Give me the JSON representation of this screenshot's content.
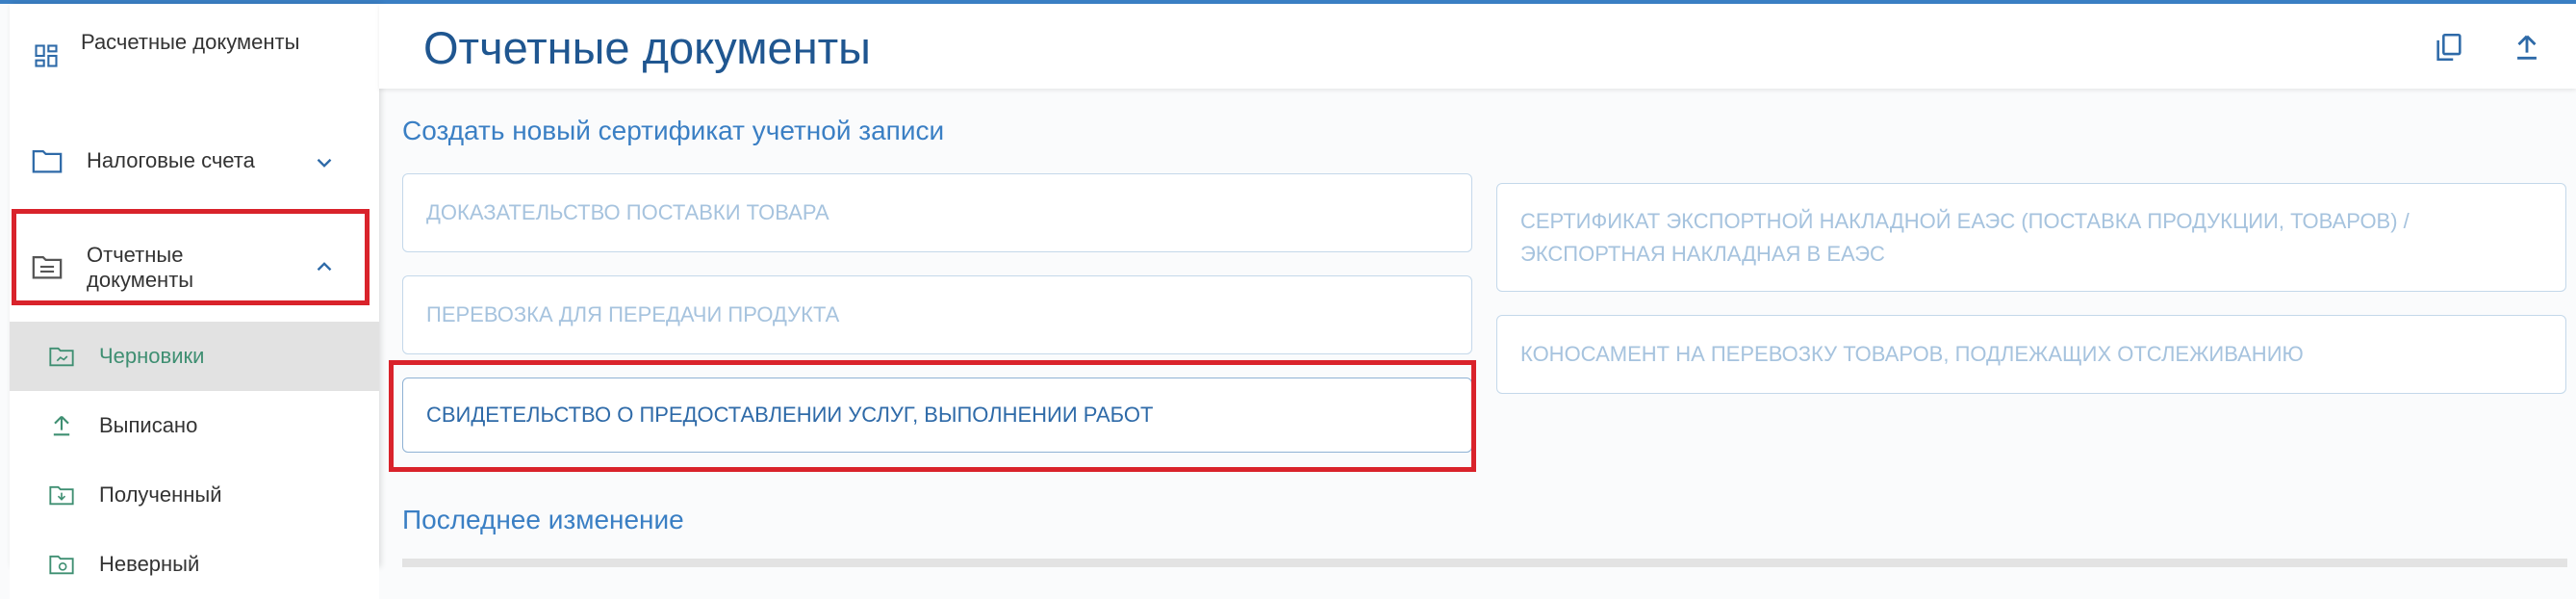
{
  "sidebar": {
    "header_label": "Расчетные документы",
    "items": [
      {
        "label": "Налоговые счета",
        "expanded": false
      },
      {
        "label": "Отчетные документы",
        "expanded": true,
        "children": [
          {
            "label": "Черновики",
            "active": true
          },
          {
            "label": "Выписано"
          },
          {
            "label": "Полученный"
          },
          {
            "label": "Неверный"
          }
        ]
      }
    ]
  },
  "header": {
    "title": "Отчетные документы",
    "icons": [
      "copy-icon",
      "upload-icon"
    ]
  },
  "create_section": {
    "title": "Создать новый сертификат учетной записи",
    "left_cards": [
      "ДОКАЗАТЕЛЬСТВО ПОСТАВКИ ТОВАРА",
      "ПЕРЕВОЗКА ДЛЯ ПЕРЕДАЧИ ПРОДУКТА",
      "СВИДЕТЕЛЬСТВО О ПРЕДОСТАВЛЕНИИ УСЛУГ, ВЫПОЛНЕНИИ РАБОТ"
    ],
    "right_cards": [
      "СЕРТИФИКАТ ЭКСПОРТНОЙ НАКЛАДНОЙ ЕАЭС (ПОСТАВКА ПРОДУКЦИИ, ТОВАРОВ) / ЭКСПОРТНАЯ НАКЛАДНАЯ В ЕАЭС",
      "КОНОСАМЕНТ НА ПЕРЕВОЗКУ ТОВАРОВ, ПОДЛЕЖАЩИХ ОТСЛЕЖИВАНИЮ"
    ]
  },
  "last_change": {
    "title": "Последнее изменение"
  },
  "colors": {
    "accent": "#3a7fc4",
    "title": "#1f5690",
    "highlight": "#d9232b",
    "active_text": "#3f8f72"
  }
}
